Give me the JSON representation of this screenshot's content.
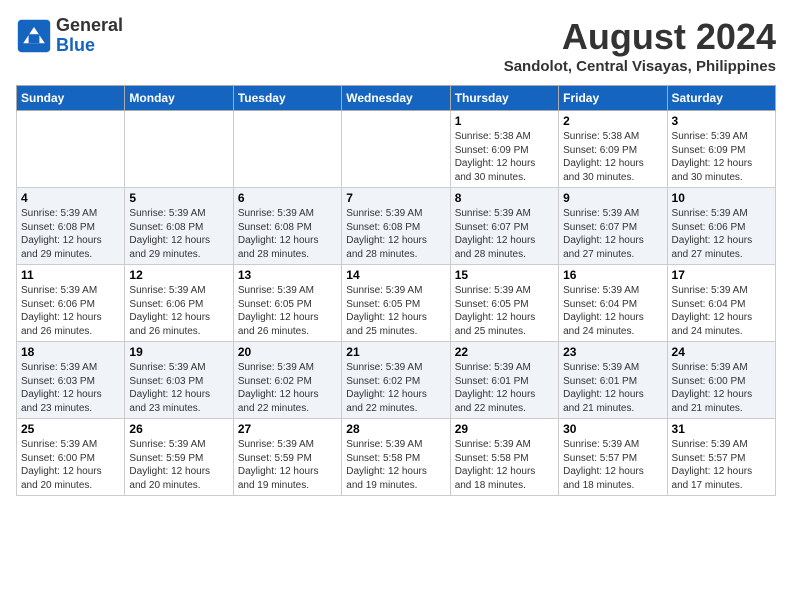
{
  "header": {
    "logo": {
      "general": "General",
      "blue": "Blue"
    },
    "title": "August 2024",
    "location": "Sandolot, Central Visayas, Philippines"
  },
  "days_of_week": [
    "Sunday",
    "Monday",
    "Tuesday",
    "Wednesday",
    "Thursday",
    "Friday",
    "Saturday"
  ],
  "weeks": [
    [
      {
        "day": "",
        "info": ""
      },
      {
        "day": "",
        "info": ""
      },
      {
        "day": "",
        "info": ""
      },
      {
        "day": "",
        "info": ""
      },
      {
        "day": "1",
        "info": "Sunrise: 5:38 AM\nSunset: 6:09 PM\nDaylight: 12 hours\nand 30 minutes."
      },
      {
        "day": "2",
        "info": "Sunrise: 5:38 AM\nSunset: 6:09 PM\nDaylight: 12 hours\nand 30 minutes."
      },
      {
        "day": "3",
        "info": "Sunrise: 5:39 AM\nSunset: 6:09 PM\nDaylight: 12 hours\nand 30 minutes."
      }
    ],
    [
      {
        "day": "4",
        "info": "Sunrise: 5:39 AM\nSunset: 6:08 PM\nDaylight: 12 hours\nand 29 minutes."
      },
      {
        "day": "5",
        "info": "Sunrise: 5:39 AM\nSunset: 6:08 PM\nDaylight: 12 hours\nand 29 minutes."
      },
      {
        "day": "6",
        "info": "Sunrise: 5:39 AM\nSunset: 6:08 PM\nDaylight: 12 hours\nand 28 minutes."
      },
      {
        "day": "7",
        "info": "Sunrise: 5:39 AM\nSunset: 6:08 PM\nDaylight: 12 hours\nand 28 minutes."
      },
      {
        "day": "8",
        "info": "Sunrise: 5:39 AM\nSunset: 6:07 PM\nDaylight: 12 hours\nand 28 minutes."
      },
      {
        "day": "9",
        "info": "Sunrise: 5:39 AM\nSunset: 6:07 PM\nDaylight: 12 hours\nand 27 minutes."
      },
      {
        "day": "10",
        "info": "Sunrise: 5:39 AM\nSunset: 6:06 PM\nDaylight: 12 hours\nand 27 minutes."
      }
    ],
    [
      {
        "day": "11",
        "info": "Sunrise: 5:39 AM\nSunset: 6:06 PM\nDaylight: 12 hours\nand 26 minutes."
      },
      {
        "day": "12",
        "info": "Sunrise: 5:39 AM\nSunset: 6:06 PM\nDaylight: 12 hours\nand 26 minutes."
      },
      {
        "day": "13",
        "info": "Sunrise: 5:39 AM\nSunset: 6:05 PM\nDaylight: 12 hours\nand 26 minutes."
      },
      {
        "day": "14",
        "info": "Sunrise: 5:39 AM\nSunset: 6:05 PM\nDaylight: 12 hours\nand 25 minutes."
      },
      {
        "day": "15",
        "info": "Sunrise: 5:39 AM\nSunset: 6:05 PM\nDaylight: 12 hours\nand 25 minutes."
      },
      {
        "day": "16",
        "info": "Sunrise: 5:39 AM\nSunset: 6:04 PM\nDaylight: 12 hours\nand 24 minutes."
      },
      {
        "day": "17",
        "info": "Sunrise: 5:39 AM\nSunset: 6:04 PM\nDaylight: 12 hours\nand 24 minutes."
      }
    ],
    [
      {
        "day": "18",
        "info": "Sunrise: 5:39 AM\nSunset: 6:03 PM\nDaylight: 12 hours\nand 23 minutes."
      },
      {
        "day": "19",
        "info": "Sunrise: 5:39 AM\nSunset: 6:03 PM\nDaylight: 12 hours\nand 23 minutes."
      },
      {
        "day": "20",
        "info": "Sunrise: 5:39 AM\nSunset: 6:02 PM\nDaylight: 12 hours\nand 22 minutes."
      },
      {
        "day": "21",
        "info": "Sunrise: 5:39 AM\nSunset: 6:02 PM\nDaylight: 12 hours\nand 22 minutes."
      },
      {
        "day": "22",
        "info": "Sunrise: 5:39 AM\nSunset: 6:01 PM\nDaylight: 12 hours\nand 22 minutes."
      },
      {
        "day": "23",
        "info": "Sunrise: 5:39 AM\nSunset: 6:01 PM\nDaylight: 12 hours\nand 21 minutes."
      },
      {
        "day": "24",
        "info": "Sunrise: 5:39 AM\nSunset: 6:00 PM\nDaylight: 12 hours\nand 21 minutes."
      }
    ],
    [
      {
        "day": "25",
        "info": "Sunrise: 5:39 AM\nSunset: 6:00 PM\nDaylight: 12 hours\nand 20 minutes."
      },
      {
        "day": "26",
        "info": "Sunrise: 5:39 AM\nSunset: 5:59 PM\nDaylight: 12 hours\nand 20 minutes."
      },
      {
        "day": "27",
        "info": "Sunrise: 5:39 AM\nSunset: 5:59 PM\nDaylight: 12 hours\nand 19 minutes."
      },
      {
        "day": "28",
        "info": "Sunrise: 5:39 AM\nSunset: 5:58 PM\nDaylight: 12 hours\nand 19 minutes."
      },
      {
        "day": "29",
        "info": "Sunrise: 5:39 AM\nSunset: 5:58 PM\nDaylight: 12 hours\nand 18 minutes."
      },
      {
        "day": "30",
        "info": "Sunrise: 5:39 AM\nSunset: 5:57 PM\nDaylight: 12 hours\nand 18 minutes."
      },
      {
        "day": "31",
        "info": "Sunrise: 5:39 AM\nSunset: 5:57 PM\nDaylight: 12 hours\nand 17 minutes."
      }
    ]
  ]
}
